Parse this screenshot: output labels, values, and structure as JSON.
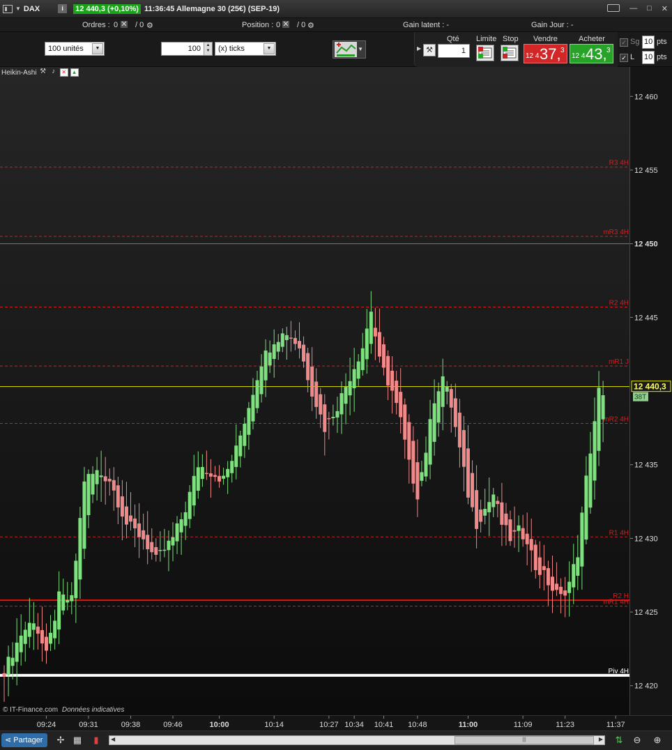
{
  "titlebar": {
    "symbol": "DAX",
    "price_badge": "12 440,3 (+0,10%)",
    "description": "11:36:45 Allemagne 30 (25€) (SEP-19)",
    "minimize": "—",
    "maximize": "□",
    "close": "✕"
  },
  "positions": {
    "orders_label": "Ordres :",
    "orders_value": "0",
    "orders_second": "/ 0",
    "position_label": "Position :",
    "position_value": "0",
    "position_second": "/ 0",
    "gain_latent": "Gain latent : -",
    "gain_jour": "Gain Jour : -"
  },
  "orderbar": {
    "quantity_select": "100 unités",
    "ticks_value": "100",
    "ticks_unit": "(x) ticks"
  },
  "trade": {
    "qty_label": "Qté",
    "qty_value": "1",
    "limit_label": "Limite",
    "stop_label": "Stop",
    "sell_label": "Vendre",
    "buy_label": "Acheter",
    "sell_prefix": "12 4",
    "sell_big": "37,",
    "sell_small": "3",
    "buy_prefix": "12 4",
    "buy_big": "43,",
    "buy_small": "3",
    "sg_label": "Sg",
    "sg_value": "10",
    "sg_unit": "pts",
    "l_label": "L",
    "l_value": "10",
    "l_unit": "pts"
  },
  "indicator": {
    "name": "Heikin-Ashi"
  },
  "credit": {
    "source": "© IT-Finance.com",
    "note": "Données indicatives"
  },
  "bottombar": {
    "share_label": "Partager"
  },
  "chart_data": {
    "type": "candlestick",
    "style": "Heikin-Ashi",
    "ylim": [
      12418,
      12462
    ],
    "yticks": [
      {
        "label": "12 460",
        "value": 12460,
        "bold": false
      },
      {
        "label": "12 455",
        "value": 12455,
        "bold": false
      },
      {
        "label": "12 450",
        "value": 12450,
        "bold": true
      },
      {
        "label": "12 445",
        "value": 12445,
        "bold": false
      },
      {
        "label": "12 435",
        "value": 12435,
        "bold": false
      },
      {
        "label": "12 430",
        "value": 12430,
        "bold": false
      },
      {
        "label": "12 425",
        "value": 12425,
        "bold": false
      },
      {
        "label": "12 420",
        "value": 12420,
        "bold": false
      }
    ],
    "xticks": [
      {
        "label": "09:24",
        "index": 10,
        "bold": false
      },
      {
        "label": "09:31",
        "index": 20,
        "bold": false
      },
      {
        "label": "09:38",
        "index": 30,
        "bold": false
      },
      {
        "label": "09:46",
        "index": 40,
        "bold": false
      },
      {
        "label": "10:00",
        "index": 51,
        "bold": true
      },
      {
        "label": "10:14",
        "index": 64,
        "bold": false
      },
      {
        "label": "10:27",
        "index": 77,
        "bold": false
      },
      {
        "label": "10:34",
        "index": 83,
        "bold": false
      },
      {
        "label": "10:41",
        "index": 90,
        "bold": false
      },
      {
        "label": "10:48",
        "index": 98,
        "bold": false
      },
      {
        "label": "11:00",
        "index": 110,
        "bold": true
      },
      {
        "label": "11:09",
        "index": 123,
        "bold": false
      },
      {
        "label": "11:23",
        "index": 133,
        "bold": false
      },
      {
        "label": "11:37",
        "index": 145,
        "bold": false
      }
    ],
    "levels": [
      {
        "label": "R3 4H",
        "value": 12455.2,
        "color": "#d02020",
        "style": "dashed",
        "width": 1
      },
      {
        "label": "mR3 4H",
        "value": 12450.5,
        "color": "#d02020",
        "style": "dashed",
        "width": 1
      },
      {
        "label": "",
        "value": 12450.0,
        "color": "#7a7a7a",
        "style": "solid",
        "width": 1
      },
      {
        "label": "R2 4H",
        "value": 12445.7,
        "color": "#d02020",
        "style": "dashed",
        "width": 1
      },
      {
        "label": "mR1 J",
        "value": 12441.7,
        "color": "#d02020",
        "style": "dashed",
        "width": 1
      },
      {
        "label": "",
        "value": 12440.3,
        "color": "#e6e600",
        "style": "solid",
        "width": 1
      },
      {
        "label": "mR2 4H",
        "value": 12437.8,
        "color": "#d02020",
        "style": "dashed",
        "width": 1
      },
      {
        "label": "R1 4H",
        "value": 12430.1,
        "color": "#d02020",
        "style": "dashed",
        "width": 1
      },
      {
        "label": "R2 H",
        "value": 12425.8,
        "color": "#e81010",
        "style": "solid",
        "width": 2
      },
      {
        "label": "mR1 4H",
        "value": 12425.4,
        "color": "#d02020",
        "style": "dashed",
        "width": 1
      },
      {
        "label": "Piv 4H",
        "value": 12420.7,
        "color": "#ffffff",
        "style": "solid",
        "width": 4
      }
    ],
    "last_price": {
      "label": "12 440,3",
      "value": 12440.3,
      "badge": "38T"
    },
    "anchors": [
      [
        0,
        12421
      ],
      [
        4,
        12423.5
      ],
      [
        7,
        12424.5
      ],
      [
        10,
        12422
      ],
      [
        13,
        12426
      ],
      [
        16,
        12425.8
      ],
      [
        19,
        12434
      ],
      [
        22,
        12434.5
      ],
      [
        25,
        12434
      ],
      [
        29,
        12431
      ],
      [
        33,
        12430
      ],
      [
        36,
        12428.5
      ],
      [
        40,
        12430
      ],
      [
        43,
        12432
      ],
      [
        46,
        12435
      ],
      [
        49,
        12434.5
      ],
      [
        52,
        12434
      ],
      [
        55,
        12436
      ],
      [
        58,
        12439
      ],
      [
        61,
        12442
      ],
      [
        64,
        12443.5
      ],
      [
        67,
        12444
      ],
      [
        70,
        12443
      ],
      [
        73,
        12440
      ],
      [
        76,
        12437.5
      ],
      [
        79,
        12439
      ],
      [
        82,
        12441
      ],
      [
        85,
        12443
      ],
      [
        87,
        12445.5
      ],
      [
        89,
        12442
      ],
      [
        92,
        12440
      ],
      [
        94,
        12438
      ],
      [
        96,
        12435
      ],
      [
        98,
        12433
      ],
      [
        100,
        12436
      ],
      [
        102,
        12439.5
      ],
      [
        104,
        12441
      ],
      [
        106,
        12439
      ],
      [
        108,
        12436
      ],
      [
        110,
        12433
      ],
      [
        112,
        12431
      ],
      [
        114,
        12432
      ],
      [
        116,
        12433
      ],
      [
        118,
        12431
      ],
      [
        120,
        12430
      ],
      [
        122,
        12430.5
      ],
      [
        124,
        12430
      ],
      [
        126,
        12428
      ],
      [
        128,
        12427.5
      ],
      [
        130,
        12426.5
      ],
      [
        132,
        12426
      ],
      [
        134,
        12427
      ],
      [
        136,
        12429
      ],
      [
        138,
        12434
      ],
      [
        140,
        12438
      ],
      [
        141,
        12440
      ],
      [
        142,
        12439.5
      ]
    ]
  }
}
